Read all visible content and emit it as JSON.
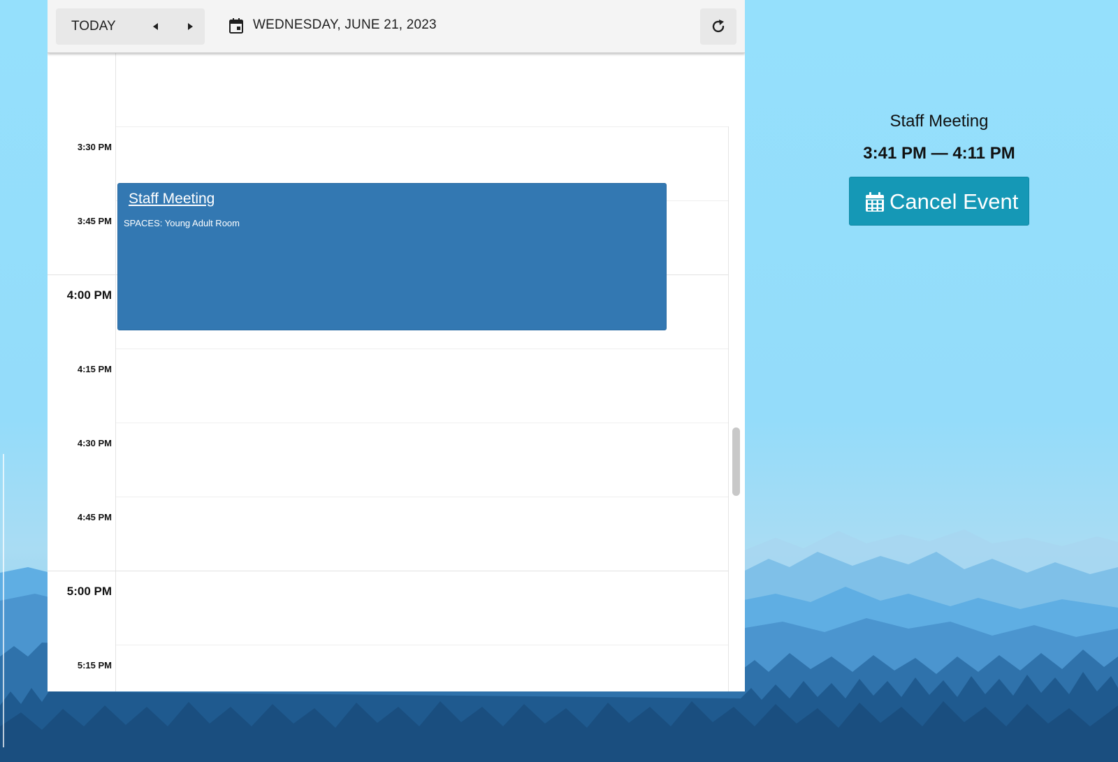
{
  "toolbar": {
    "today_label": "TODAY",
    "date_label": "WEDNESDAY, JUNE 21, 2023",
    "icons": [
      "caret-left-icon",
      "caret-right-icon",
      "calendar-icon",
      "refresh-icon"
    ]
  },
  "time_slots": [
    {
      "label": "",
      "major": false
    },
    {
      "label": "3:30 PM",
      "major": false
    },
    {
      "label": "3:45 PM",
      "major": false
    },
    {
      "label": "4:00 PM",
      "major": true
    },
    {
      "label": "4:15 PM",
      "major": false
    },
    {
      "label": "4:30 PM",
      "major": false
    },
    {
      "label": "4:45 PM",
      "major": false
    },
    {
      "label": "5:00 PM",
      "major": true
    },
    {
      "label": "5:15 PM",
      "major": false
    }
  ],
  "event": {
    "title": "Staff Meeting",
    "location": "SPACES: Young Adult Room"
  },
  "detail": {
    "title": "Staff Meeting",
    "time_range": "3:41 PM — 4:11 PM",
    "cancel_label": "Cancel Event",
    "cancel_icon": "calendar-grid-icon"
  },
  "colors": {
    "event_bg": "#3378b2",
    "cancel_bg": "#1598b6",
    "sky": "#95e0fc"
  }
}
